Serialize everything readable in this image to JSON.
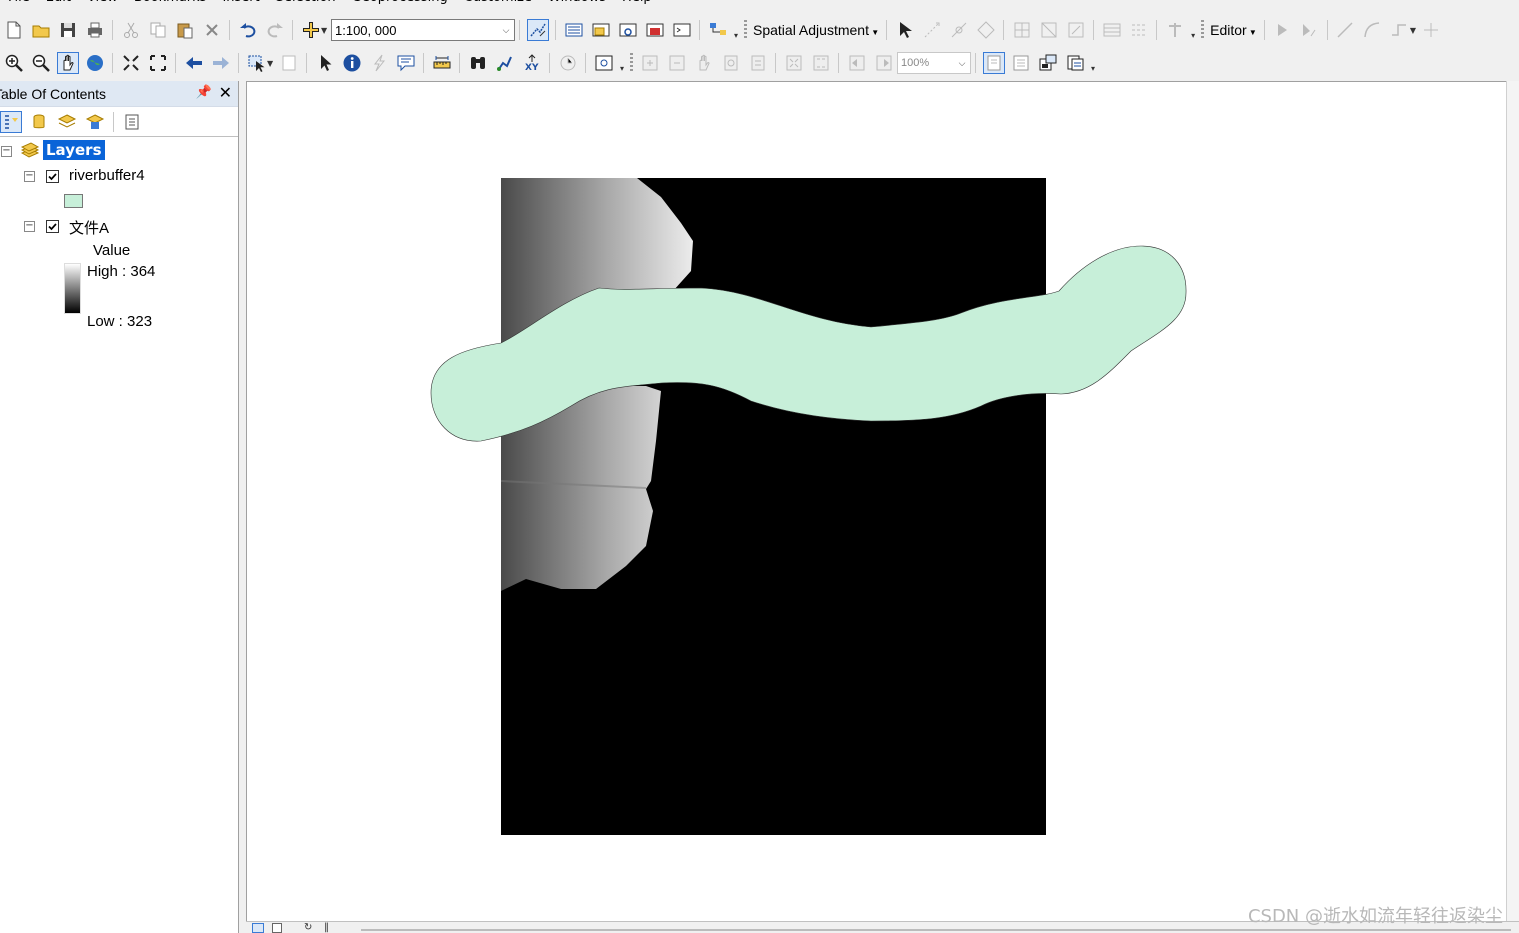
{
  "menu": [
    "File",
    "Edit",
    "View",
    "Bookmarks",
    "Insert",
    "Selection",
    "Geoprocessing",
    "Customize",
    "Windows",
    "Help"
  ],
  "toolbar1": {
    "scale_value": "1:100, 000",
    "spatial_adjustment_label": "Spatial Adjustment",
    "editor_label": "Editor"
  },
  "toolbar2": {
    "zoom_value": "100%"
  },
  "toc": {
    "title": "Table Of Contents",
    "root_label": "Layers",
    "layers": [
      {
        "name": "riverbuffer4",
        "checked": true,
        "swatch_color": "#c7efd9"
      },
      {
        "name": "文件A",
        "checked": true,
        "legend_heading": "Value",
        "high_label": "High : 364",
        "low_label": "Low : 323"
      }
    ]
  },
  "map": {
    "buffer_fill_color": "#c7efd9",
    "raster_background_color": "#000000"
  },
  "watermark": "CSDN @逝水如流年轻往返染尘"
}
